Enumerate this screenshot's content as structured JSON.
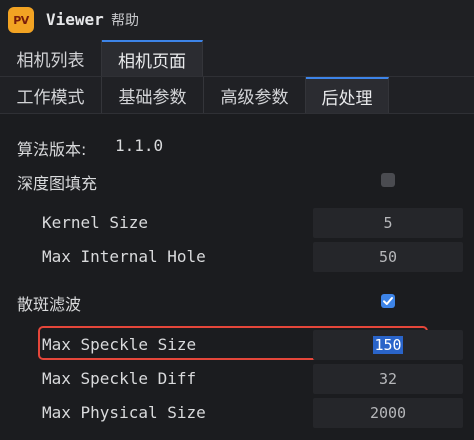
{
  "app": {
    "logo_text": "PV",
    "title": "Viewer",
    "menu_help": "帮助",
    "logo_color": "#f2a323"
  },
  "top_tabs": [
    {
      "label": "相机列表",
      "active": false
    },
    {
      "label": "相机页面",
      "active": true
    }
  ],
  "sub_tabs": [
    {
      "label": "工作模式",
      "active": false
    },
    {
      "label": "基础参数",
      "active": false
    },
    {
      "label": "高级参数",
      "active": false
    },
    {
      "label": "后处理",
      "active": true
    }
  ],
  "postprocess": {
    "version_label": "算法版本:",
    "version_value": "1.1.0",
    "depth_fill": {
      "label": "深度图填充",
      "checked": false,
      "params": [
        {
          "label": "Kernel Size",
          "value": "5"
        },
        {
          "label": "Max Internal Hole",
          "value": "50"
        }
      ]
    },
    "speckle_filter": {
      "label": "散斑滤波",
      "checked": true,
      "params": [
        {
          "label": "Max Speckle Size",
          "value": "150",
          "highlighted": true
        },
        {
          "label": "Max Speckle Diff",
          "value": "32"
        },
        {
          "label": "Max Physical Size",
          "value": "2000"
        }
      ]
    }
  },
  "colors": {
    "accent": "#3d84e8",
    "highlight_border": "#e5463a",
    "background": "#1b1c1f"
  }
}
